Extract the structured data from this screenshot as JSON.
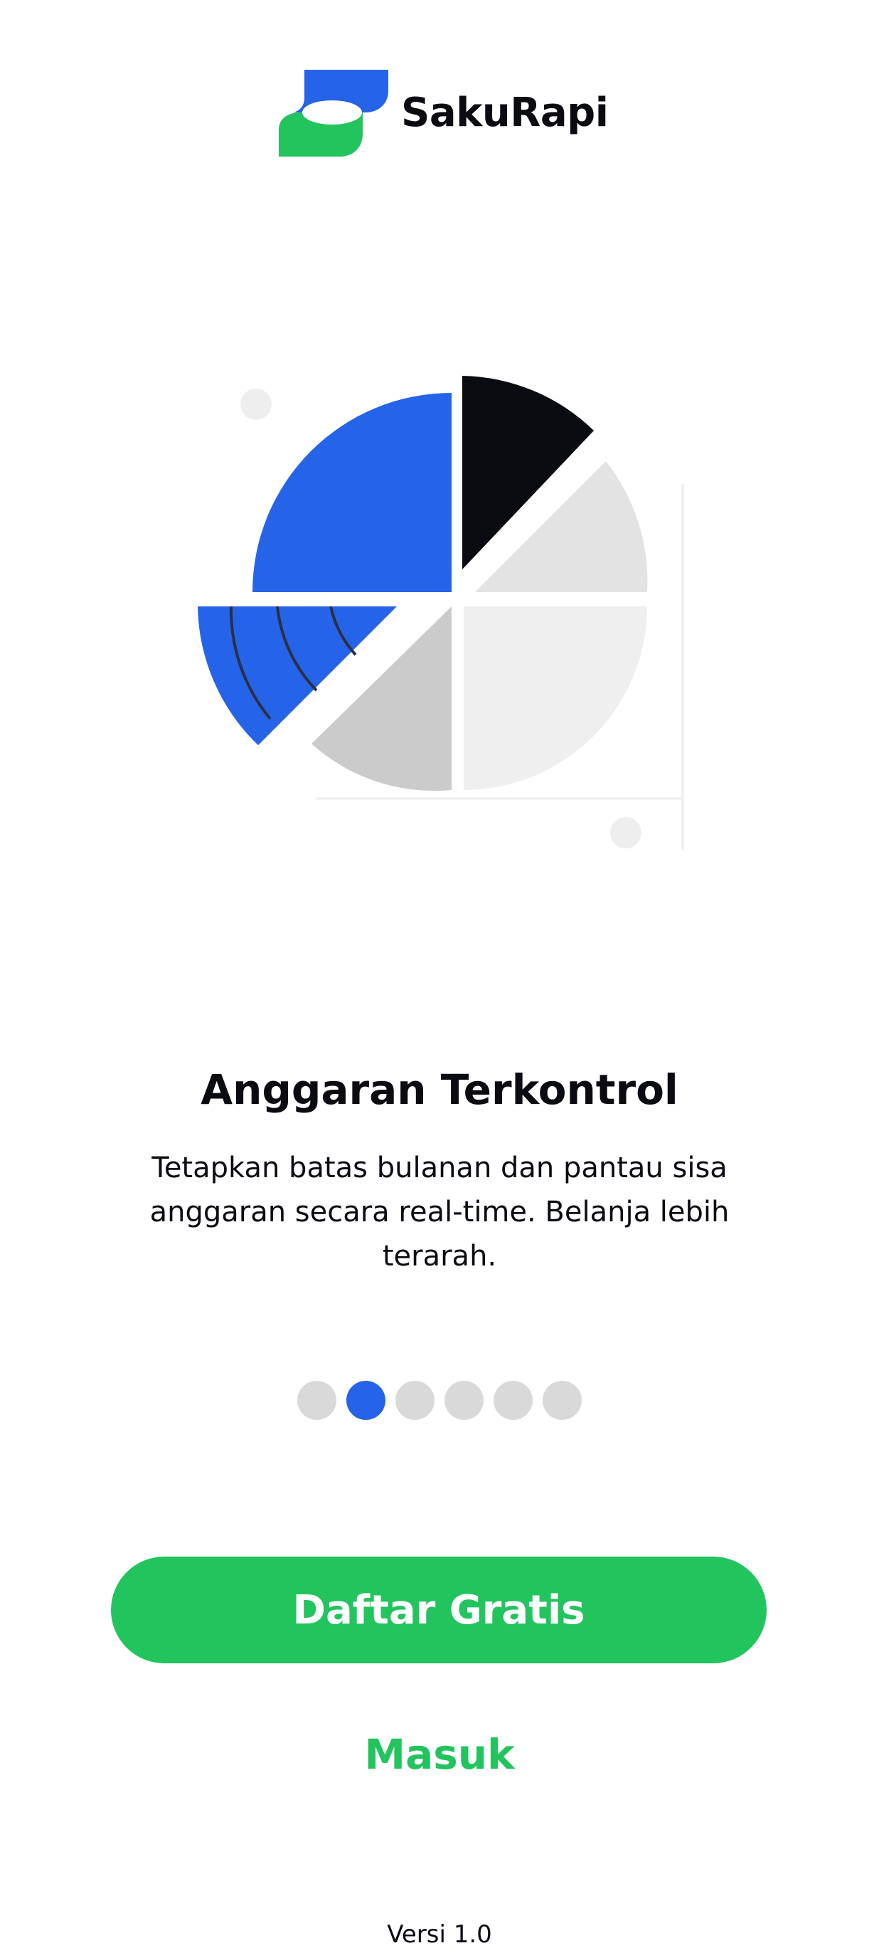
{
  "app": {
    "brand_name": "SakuRapi",
    "logo_icon": "sakurapi-logo-icon",
    "colors": {
      "blue": "#2563e8",
      "green": "#22c45e",
      "dark": "#0b0b12",
      "light_gray": "#e3e3e3",
      "mid_gray": "#cbcbcb"
    }
  },
  "onboarding": {
    "illustration_icon": "budget-pie-chart-illustration",
    "title": "Anggaran Terkontrol",
    "description": "Tetapkan batas bulanan dan pantau sisa anggaran secara real-time. Belanja lebih terarah.",
    "page_indicator": {
      "total": 6,
      "active_index": 1
    }
  },
  "actions": {
    "register_label": "Daftar Gratis",
    "login_label": "Masuk"
  },
  "footer": {
    "version": "Versi 1.0"
  }
}
